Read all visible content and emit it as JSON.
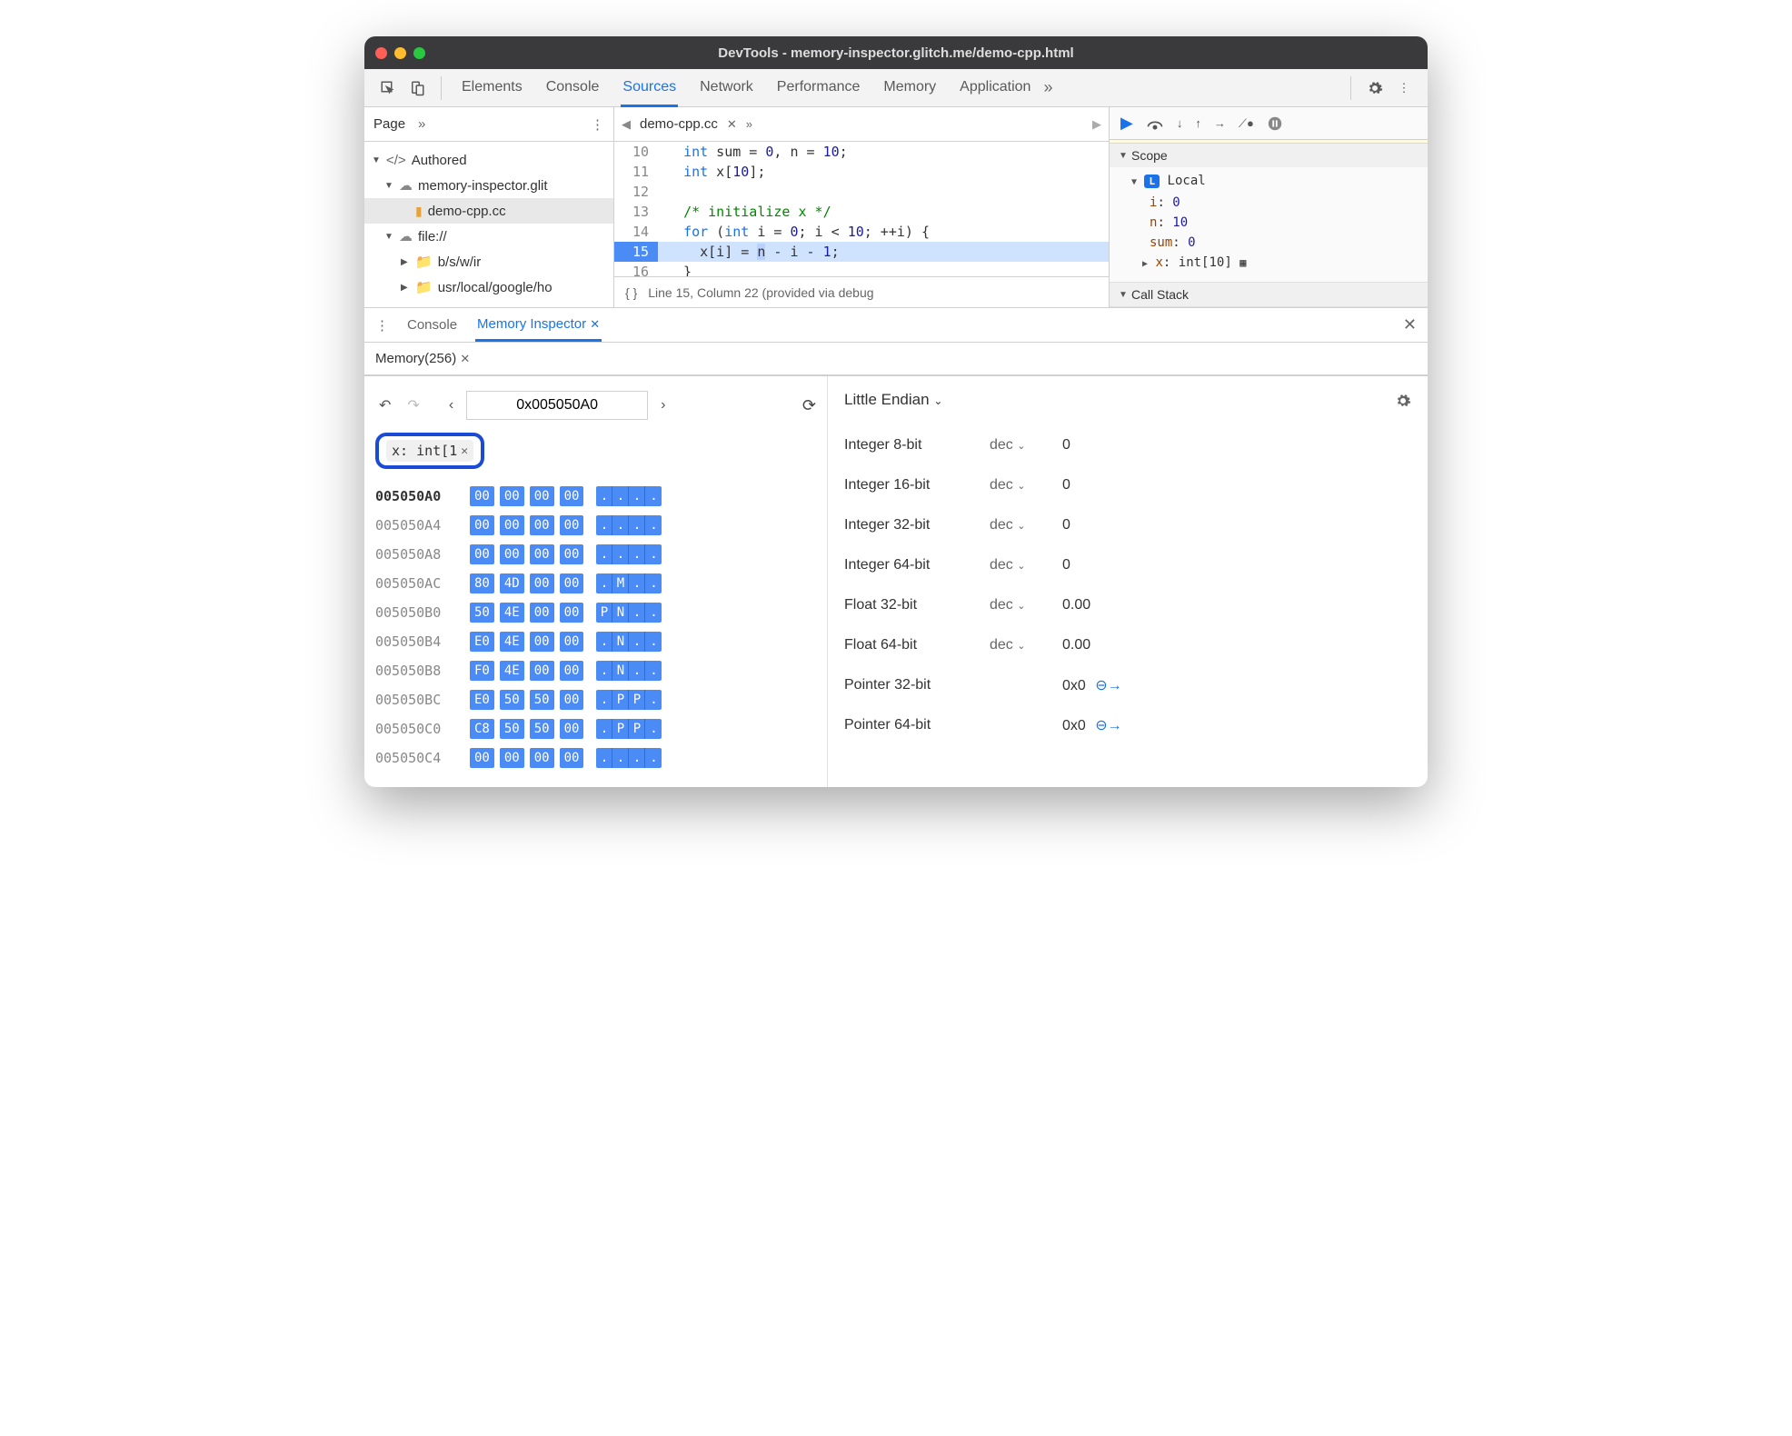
{
  "window_title": "DevTools - memory-inspector.glitch.me/demo-cpp.html",
  "main_tabs": [
    "Elements",
    "Console",
    "Sources",
    "Network",
    "Performance",
    "Memory",
    "Application"
  ],
  "active_main_tab": "Sources",
  "sidebar": {
    "page_tab": "Page",
    "tree": {
      "authored": "Authored",
      "domain": "memory-inspector.glit",
      "file": "demo-cpp.cc",
      "file_scheme": "file://",
      "folder1": "b/s/w/ir",
      "folder2": "usr/local/google/ho"
    }
  },
  "editor": {
    "filename": "demo-cpp.cc",
    "lines": [
      {
        "n": 10,
        "html": "  <span class='kw'>int</span> sum = <span class='num'>0</span>, n = <span class='num'>10</span>;"
      },
      {
        "n": 11,
        "html": "  <span class='kw'>int</span> x[<span class='num'>10</span>];"
      },
      {
        "n": 12,
        "html": ""
      },
      {
        "n": 13,
        "html": "  <span class='cm'>/* initialize x */</span>"
      },
      {
        "n": 14,
        "html": "  <span class='kw'>for</span> (<span class='kw'>int</span> i = <span class='num'>0</span>; i &lt; <span class='num'>10</span>; ++i) {"
      },
      {
        "n": 15,
        "html": "    x[i] = <span class='selvar'>n</span> - i - <span class='num'>1</span>;",
        "hl": true
      },
      {
        "n": 16,
        "html": "  }"
      }
    ],
    "status": "Line 15, Column 22 (provided via debug"
  },
  "scope": {
    "title": "Scope",
    "local": "Local",
    "vars": [
      {
        "k": "i",
        "v": "0"
      },
      {
        "k": "n",
        "v": "10"
      },
      {
        "k": "sum",
        "v": "0"
      }
    ],
    "x_label": "x",
    "x_type": "int[10]"
  },
  "callstack_title": "Call Stack",
  "drawer": {
    "console": "Console",
    "mem_inspector": "Memory Inspector",
    "mem_tab": "Memory(256)"
  },
  "memory": {
    "address": "0x005050A0",
    "chip": "x: int[1",
    "endian": "Little Endian",
    "rows": [
      {
        "addr": "005050A0",
        "b": [
          "00",
          "00",
          "00",
          "00"
        ],
        "a": [
          ".",
          ".",
          ".",
          "."
        ],
        "bold": true
      },
      {
        "addr": "005050A4",
        "b": [
          "00",
          "00",
          "00",
          "00"
        ],
        "a": [
          ".",
          ".",
          ".",
          "."
        ]
      },
      {
        "addr": "005050A8",
        "b": [
          "00",
          "00",
          "00",
          "00"
        ],
        "a": [
          ".",
          ".",
          ".",
          "."
        ]
      },
      {
        "addr": "005050AC",
        "b": [
          "80",
          "4D",
          "00",
          "00"
        ],
        "a": [
          ".",
          "M",
          ".",
          "."
        ]
      },
      {
        "addr": "005050B0",
        "b": [
          "50",
          "4E",
          "00",
          "00"
        ],
        "a": [
          "P",
          "N",
          ".",
          "."
        ]
      },
      {
        "addr": "005050B4",
        "b": [
          "E0",
          "4E",
          "00",
          "00"
        ],
        "a": [
          ".",
          "N",
          ".",
          "."
        ]
      },
      {
        "addr": "005050B8",
        "b": [
          "F0",
          "4E",
          "00",
          "00"
        ],
        "a": [
          ".",
          "N",
          ".",
          "."
        ]
      },
      {
        "addr": "005050BC",
        "b": [
          "E0",
          "50",
          "50",
          "00"
        ],
        "a": [
          ".",
          "P",
          "P",
          "."
        ]
      },
      {
        "addr": "005050C0",
        "b": [
          "C8",
          "50",
          "50",
          "00"
        ],
        "a": [
          ".",
          "P",
          "P",
          "."
        ]
      },
      {
        "addr": "005050C4",
        "b": [
          "00",
          "00",
          "00",
          "00"
        ],
        "a": [
          ".",
          ".",
          ".",
          "."
        ]
      }
    ],
    "values": [
      {
        "label": "Integer 8-bit",
        "fmt": "dec",
        "val": "0"
      },
      {
        "label": "Integer 16-bit",
        "fmt": "dec",
        "val": "0"
      },
      {
        "label": "Integer 32-bit",
        "fmt": "dec",
        "val": "0"
      },
      {
        "label": "Integer 64-bit",
        "fmt": "dec",
        "val": "0"
      },
      {
        "label": "Float 32-bit",
        "fmt": "dec",
        "val": "0.00"
      },
      {
        "label": "Float 64-bit",
        "fmt": "dec",
        "val": "0.00"
      },
      {
        "label": "Pointer 32-bit",
        "fmt": "",
        "val": "0x0",
        "jump": true
      },
      {
        "label": "Pointer 64-bit",
        "fmt": "",
        "val": "0x0",
        "jump": true
      }
    ]
  }
}
